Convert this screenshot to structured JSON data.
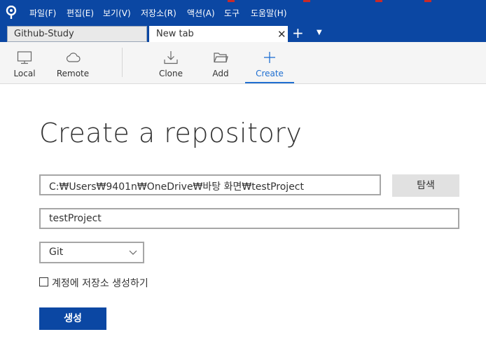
{
  "menu": {
    "items": [
      "파일(F)",
      "편집(E)",
      "보기(V)",
      "저장소(R)",
      "액션(A)",
      "도구",
      "도움말(H)"
    ]
  },
  "tabs": [
    {
      "label": "Github-Study"
    },
    {
      "label": "New tab"
    }
  ],
  "toolbar": {
    "local": "Local",
    "remote": "Remote",
    "clone": "Clone",
    "add": "Add",
    "create": "Create"
  },
  "main": {
    "title": "Create a repository",
    "path_value": "C:₩Users₩9401n₩OneDrive₩바탕 화면₩testProject",
    "browse_label": "탐색",
    "name_value": "testProject",
    "repo_type": "Git",
    "create_account_repo_label": "계정에 저장소 생성하기",
    "create_account_repo_checked": false,
    "create_button": "생성"
  },
  "colors": {
    "brand": "#0b47a3",
    "accent": "#1f6fd1"
  },
  "icons": {
    "local": "monitor-icon",
    "remote": "cloud-icon",
    "clone": "download-icon",
    "add": "folder-icon",
    "create": "plus-icon"
  }
}
